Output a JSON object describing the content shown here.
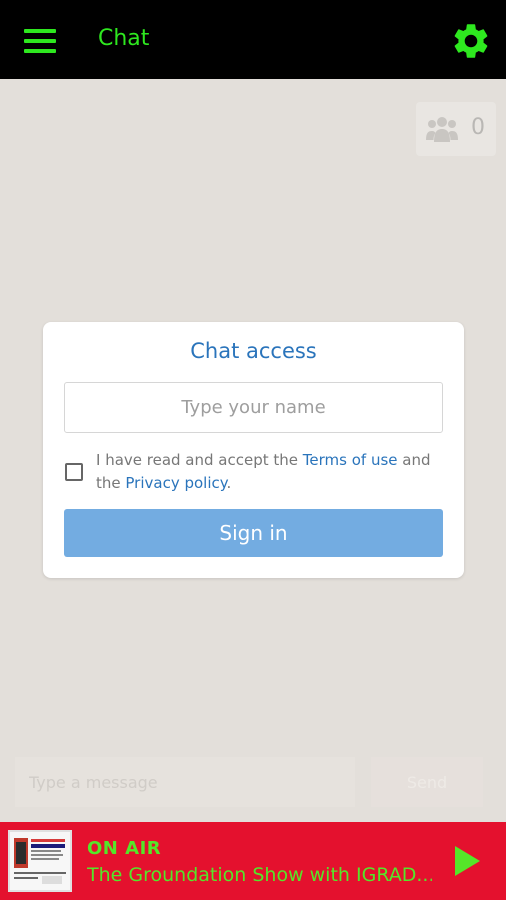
{
  "header": {
    "title": "Chat",
    "menu_icon": "hamburger-menu-icon",
    "settings_icon": "gear-icon",
    "accent_color": "#2ee81f"
  },
  "users": {
    "icon": "users-group-icon",
    "count": "0"
  },
  "dialog": {
    "title": "Chat access",
    "name_placeholder": "Type your name",
    "name_value": "",
    "terms_prefix": "I have read and accept the ",
    "terms_link": "Terms of use",
    "terms_middle": " and the ",
    "privacy_link": "Privacy policy",
    "terms_suffix": ".",
    "signin_label": "Sign in",
    "accent_color": "#2a74bb",
    "button_color": "#73ace1"
  },
  "composer": {
    "message_placeholder": "Type a message",
    "send_label": "Send"
  },
  "player": {
    "status": "ON AIR",
    "show_title": "The Groundation Show with IGRAD...",
    "cover_icon": "show-cover-image",
    "play_icon": "play-icon",
    "background_color": "#e4112e",
    "text_color": "#55e629"
  }
}
